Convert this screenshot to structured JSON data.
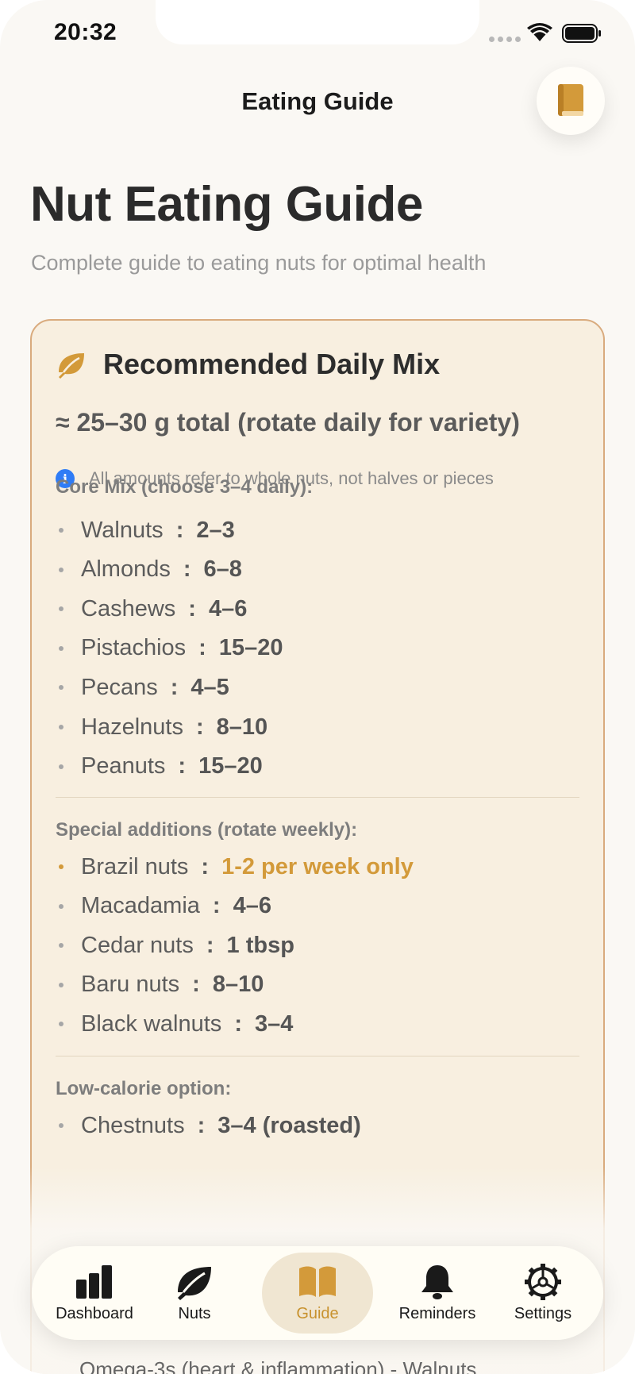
{
  "status": {
    "time": "20:32"
  },
  "nav": {
    "title": "Eating Guide"
  },
  "header": {
    "title": "Nut Eating Guide",
    "subtitle": "Complete guide to eating nuts for optimal health"
  },
  "card": {
    "title": "Recommended Daily Mix",
    "total": "≈ 25–30 g total (rotate daily for variety)",
    "info": "All amounts refer to whole nuts, not halves or pieces",
    "core_heading": "Core Mix (choose 3–4 daily):",
    "core_items": [
      {
        "name": "Walnuts",
        "amount": "2–3"
      },
      {
        "name": "Almonds",
        "amount": "6–8"
      },
      {
        "name": "Cashews",
        "amount": "4–6"
      },
      {
        "name": "Pistachios",
        "amount": "15–20"
      },
      {
        "name": "Pecans",
        "amount": "4–5"
      },
      {
        "name": "Hazelnuts",
        "amount": "8–10"
      },
      {
        "name": "Peanuts",
        "amount": "15–20"
      }
    ],
    "special_heading": "Special additions (rotate weekly):",
    "special_items": [
      {
        "name": "Brazil nuts",
        "amount": "1-2 per week only"
      },
      {
        "name": "Macadamia",
        "amount": "4–6"
      },
      {
        "name": "Cedar nuts",
        "amount": "1 tbsp"
      },
      {
        "name": "Baru nuts",
        "amount": "8–10"
      },
      {
        "name": "Black walnuts",
        "amount": "3–4"
      }
    ],
    "lowcal_heading": "Low-calorie option:",
    "lowcal_items": [
      {
        "name": "Chestnuts",
        "amount": "3–4 (roasted)"
      }
    ],
    "faded_line": "Omega-3s (heart & inflammation) - Walnuts"
  },
  "tabs": [
    {
      "label": "Dashboard",
      "icon": "chart-bars-icon"
    },
    {
      "label": "Nuts",
      "icon": "leaf-icon"
    },
    {
      "label": "Guide",
      "icon": "book-open-icon"
    },
    {
      "label": "Reminders",
      "icon": "bell-icon"
    },
    {
      "label": "Settings",
      "icon": "gear-icon"
    }
  ],
  "colors": {
    "accent": "#c8922e",
    "card_bg": "#f8efe0",
    "card_border": "#d9ab7e",
    "info_blue": "#2f7cf6"
  }
}
